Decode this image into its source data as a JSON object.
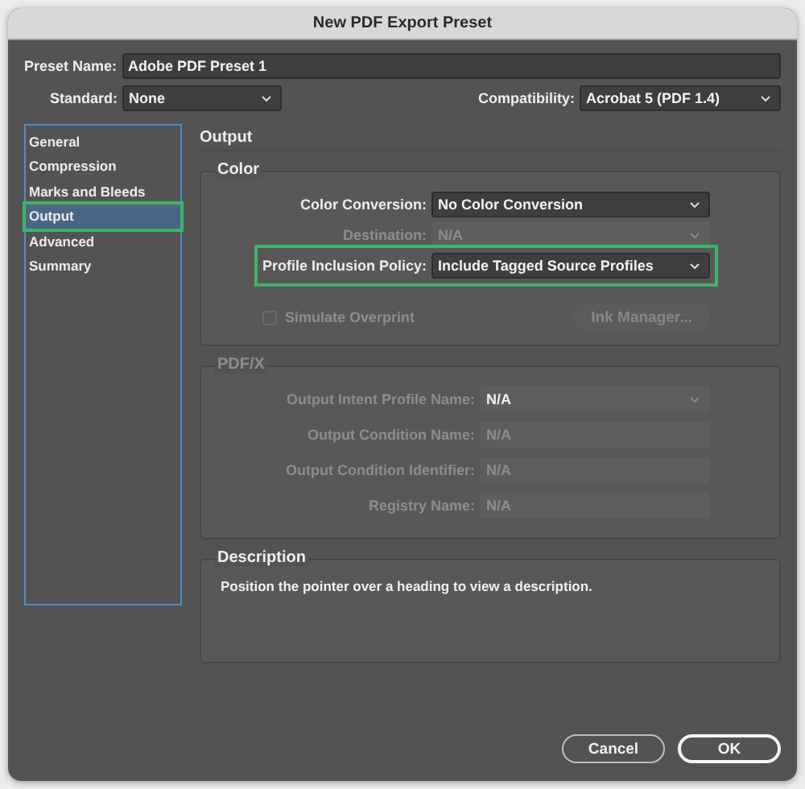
{
  "window": {
    "title": "New PDF Export Preset"
  },
  "preset_name": {
    "label": "Preset Name:",
    "value": "Adobe PDF Preset 1"
  },
  "standard": {
    "label": "Standard:",
    "value": "None"
  },
  "compatibility": {
    "label": "Compatibility:",
    "value": "Acrobat 5 (PDF 1.4)"
  },
  "sidebar": {
    "items": [
      {
        "label": "General",
        "selected": false,
        "highlighted": false
      },
      {
        "label": "Compression",
        "selected": false,
        "highlighted": false
      },
      {
        "label": "Marks and Bleeds",
        "selected": false,
        "highlighted": false
      },
      {
        "label": "Output",
        "selected": true,
        "highlighted": true
      },
      {
        "label": "Advanced",
        "selected": false,
        "highlighted": false
      },
      {
        "label": "Summary",
        "selected": false,
        "highlighted": false
      }
    ]
  },
  "panel": {
    "title": "Output"
  },
  "color_group": {
    "title": "Color",
    "rows": [
      {
        "label": "Color Conversion:",
        "value": "No Color Conversion",
        "kind": "dropdown",
        "disabled": false,
        "highlighted": false
      },
      {
        "label": "Destination:",
        "value": "N/A",
        "kind": "dropdown",
        "disabled": true,
        "highlighted": false
      },
      {
        "label": "Profile Inclusion Policy:",
        "value": "Include Tagged Source Profiles",
        "kind": "dropdown",
        "disabled": false,
        "highlighted": true
      }
    ],
    "simulate_overprint": {
      "label": "Simulate Overprint",
      "checked": false,
      "disabled": true
    },
    "ink_manager": {
      "label": "Ink Manager...",
      "disabled": true
    }
  },
  "pdfx_group": {
    "title": "PDF/X",
    "rows": [
      {
        "label": "Output Intent Profile Name:",
        "value": "N/A",
        "kind": "dropdown",
        "disabled": true
      },
      {
        "label": "Output Condition Name:",
        "value": "N/A",
        "kind": "field",
        "disabled": true
      },
      {
        "label": "Output Condition Identifier:",
        "value": "N/A",
        "kind": "field",
        "disabled": true
      },
      {
        "label": "Registry Name:",
        "value": "N/A",
        "kind": "field",
        "disabled": true
      }
    ]
  },
  "description": {
    "title": "Description",
    "text": "Position the pointer over a heading to view a description."
  },
  "buttons": [
    {
      "label": "Cancel",
      "default": false
    },
    {
      "label": "OK",
      "default": true
    }
  ]
}
